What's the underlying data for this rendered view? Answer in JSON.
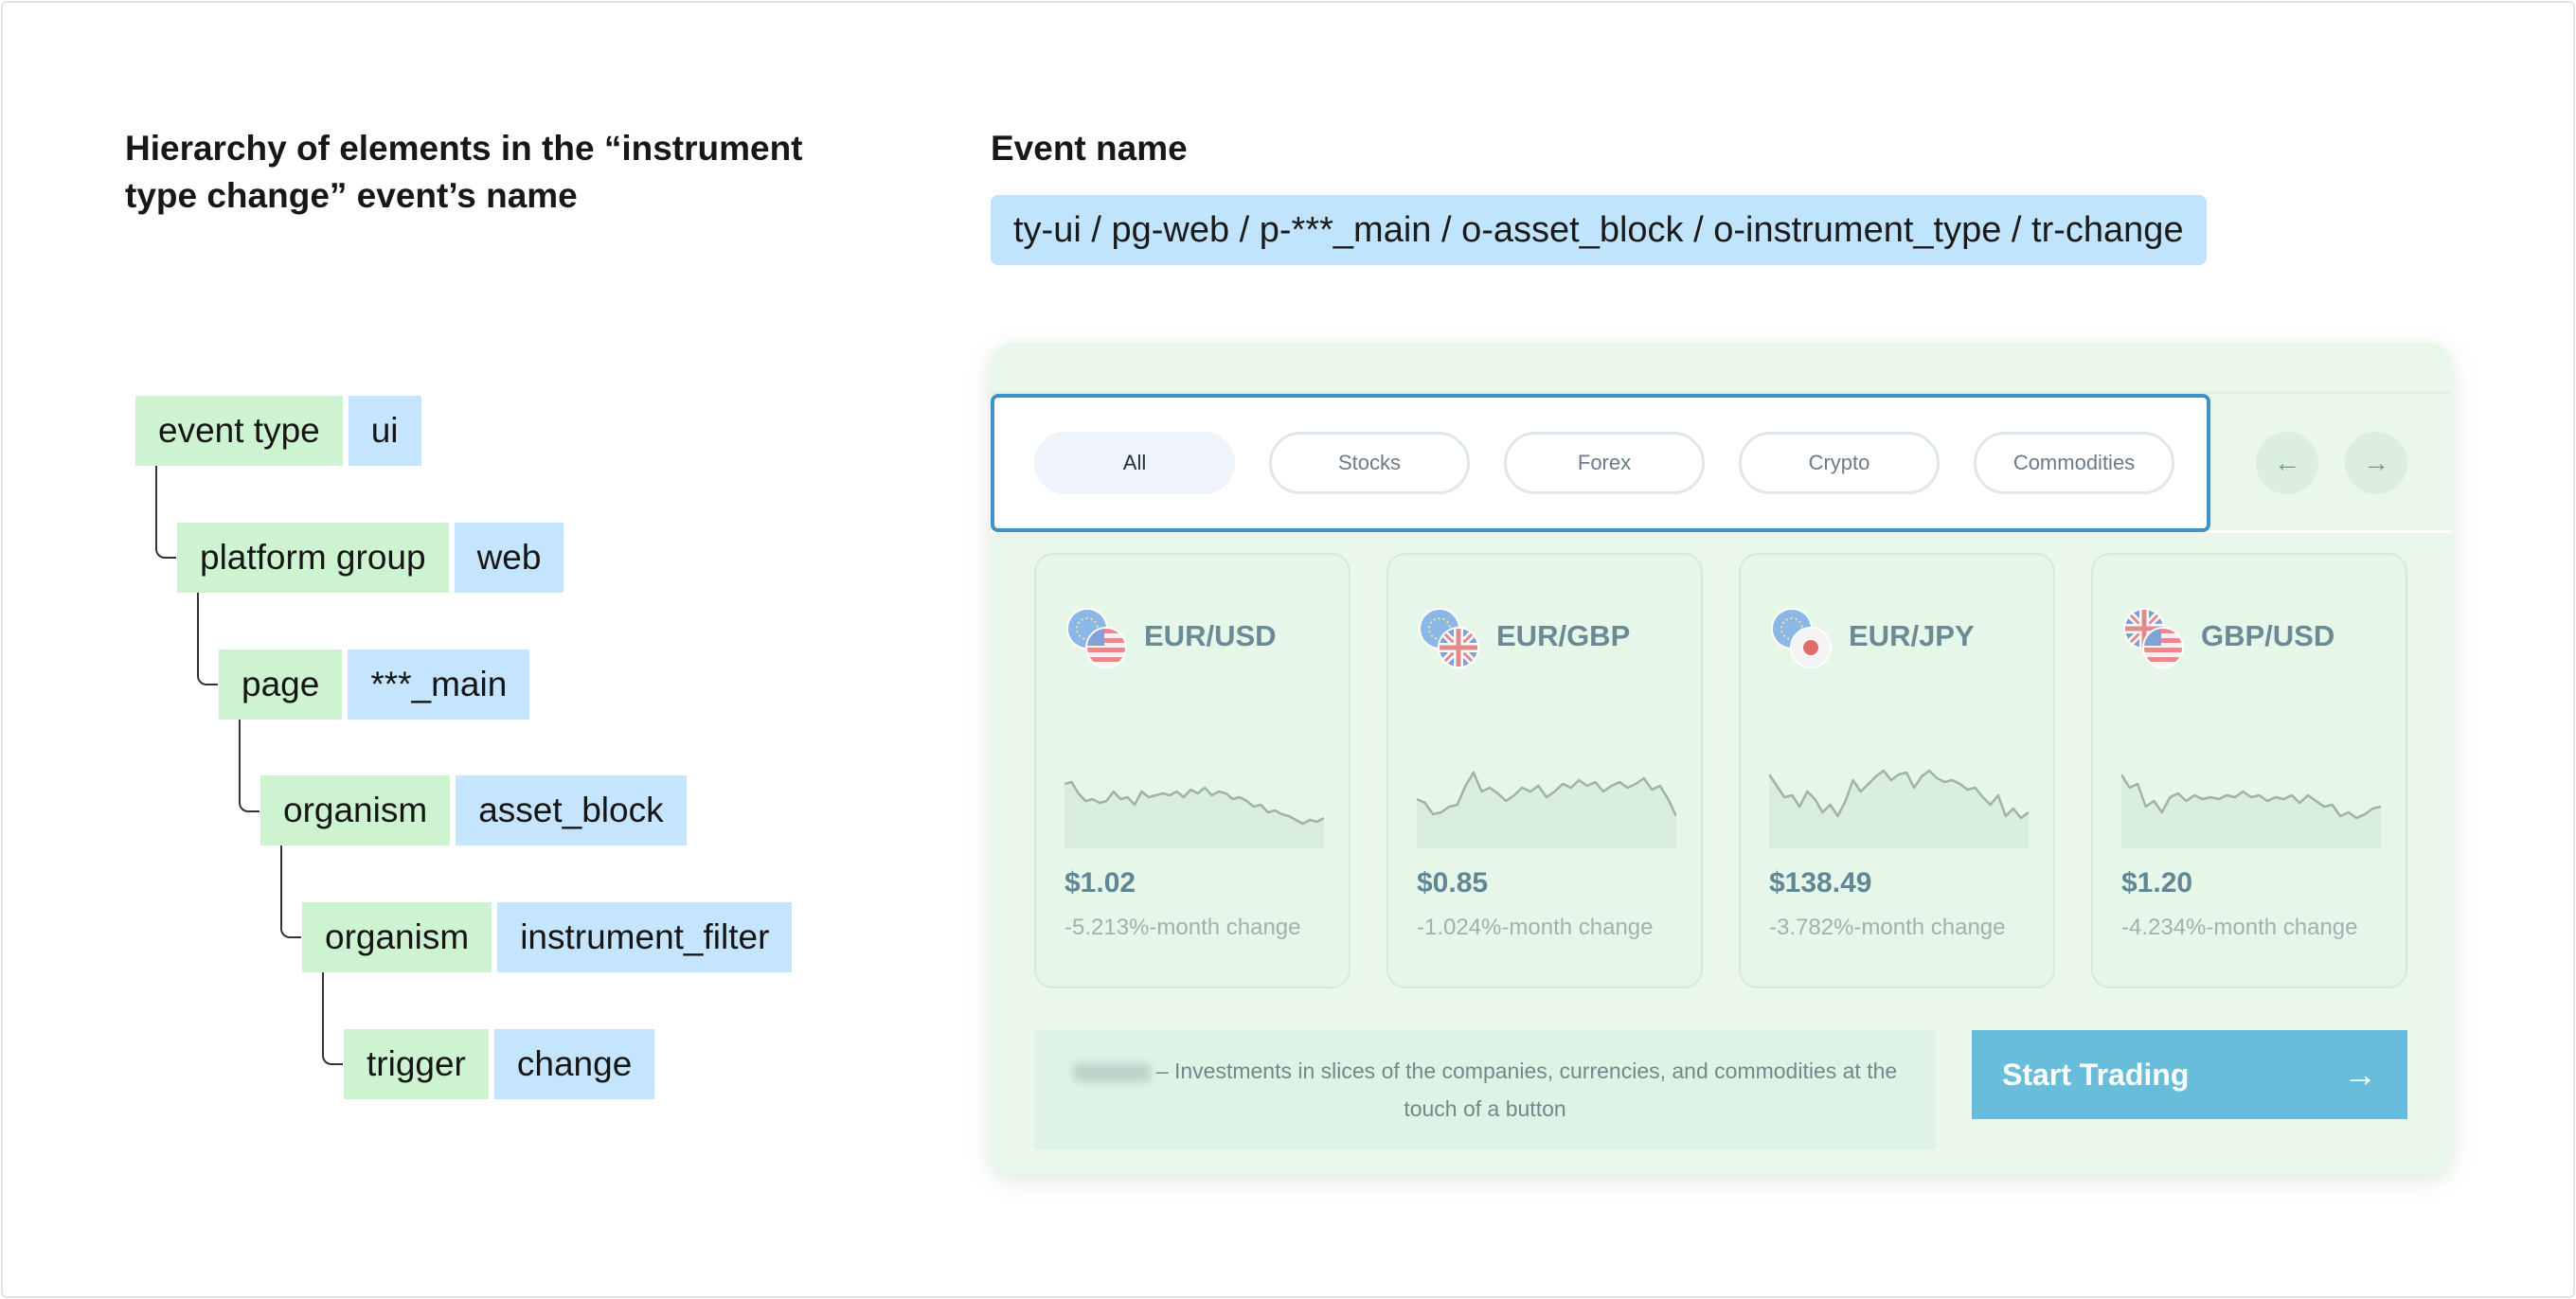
{
  "left_heading": "Hierarchy of elements in the “instrument type change” event’s name",
  "right_heading": "Event name",
  "event_name": "ty-ui / pg-web / p-***_main / o-asset_block / o-instrument_type / tr-change",
  "hierarchy": [
    {
      "key": "event type",
      "value": "ui"
    },
    {
      "key": "platform group",
      "value": "web"
    },
    {
      "key": "page",
      "value": "***_main"
    },
    {
      "key": "organism",
      "value": "asset_block"
    },
    {
      "key": "organism",
      "value": "instrument_filter"
    },
    {
      "key": "trigger",
      "value": "change"
    }
  ],
  "widget": {
    "filters": [
      "All",
      "Stocks",
      "Forex",
      "Crypto",
      "Commodities"
    ],
    "active_filter": "All",
    "prev_icon": "arrow-left-icon",
    "next_icon": "arrow-right-icon",
    "cards": [
      {
        "pair": "EUR/USD",
        "price": "$1.02",
        "change": "-5.213%-month change",
        "flags": [
          "eu",
          "us"
        ],
        "spark": [
          62,
          60,
          72,
          80,
          78,
          82,
          80,
          70,
          78,
          76,
          84,
          70,
          76,
          74,
          72,
          74,
          70,
          76,
          68,
          72,
          66,
          74,
          70,
          72,
          78,
          76,
          80,
          86,
          84,
          92,
          90,
          94,
          96,
          100,
          104,
          100,
          102,
          98
        ]
      },
      {
        "pair": "EUR/GBP",
        "price": "$0.85",
        "change": "-1.024%-month change",
        "flags": [
          "eu",
          "gb"
        ],
        "spark": [
          78,
          82,
          94,
          92,
          86,
          84,
          64,
          50,
          70,
          66,
          72,
          80,
          74,
          66,
          70,
          64,
          76,
          70,
          62,
          66,
          58,
          64,
          60,
          70,
          64,
          60,
          66,
          62,
          56,
          68,
          64,
          78,
          96
        ]
      },
      {
        "pair": "EUR/JPY",
        "price": "$138.49",
        "change": "-3.782%-month change",
        "flags": [
          "eu",
          "jp"
        ],
        "spark": [
          52,
          64,
          76,
          74,
          86,
          70,
          78,
          92,
          84,
          96,
          80,
          58,
          70,
          62,
          54,
          48,
          58,
          52,
          50,
          66,
          54,
          48,
          56,
          60,
          58,
          62,
          68,
          66,
          76,
          84,
          74,
          96,
          88,
          98,
          92
        ]
      },
      {
        "pair": "GBP/USD",
        "price": "$1.20",
        "change": "-4.234%-month change",
        "flags": [
          "gb",
          "us"
        ],
        "spark": [
          52,
          66,
          62,
          86,
          80,
          92,
          76,
          72,
          80,
          74,
          78,
          76,
          78,
          74,
          76,
          70,
          76,
          74,
          80,
          76,
          78,
          74,
          82,
          74,
          80,
          86,
          84,
          96,
          92,
          98,
          94,
          88,
          86
        ]
      }
    ],
    "promo_text": "– Investments in slices of the companies, currencies, and commodities at the touch of a button",
    "start_label": "Start Trading",
    "start_icon": "arrow-right-icon"
  }
}
